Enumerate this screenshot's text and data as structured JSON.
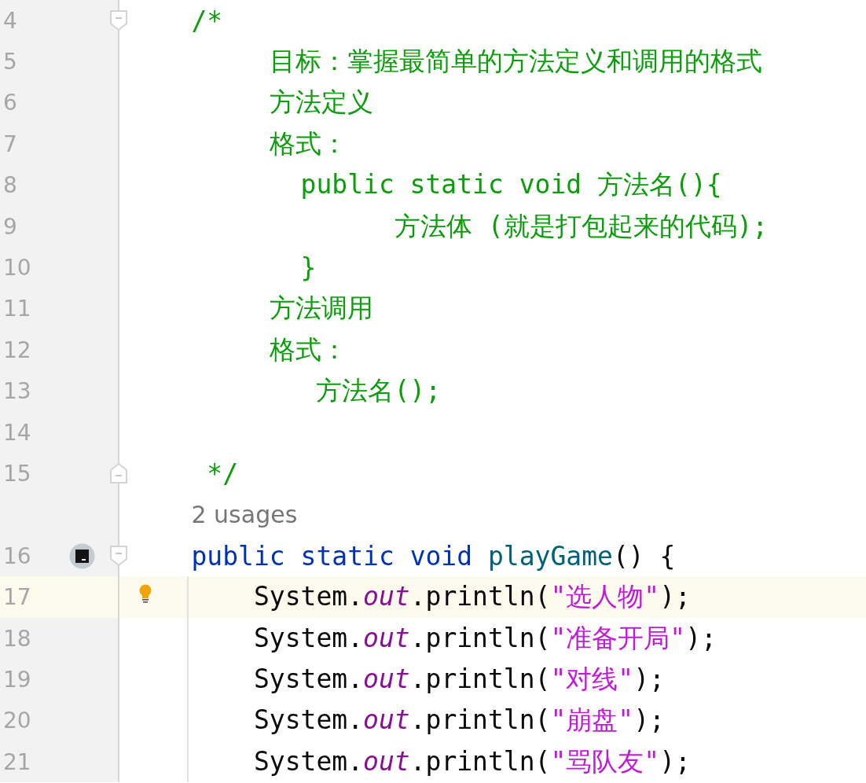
{
  "editor": {
    "lines": [
      {
        "kind": "code",
        "number": "4",
        "fold_start": true,
        "tokens": [
          {
            "kind": "comment",
            "text": "    /*"
          }
        ]
      },
      {
        "kind": "code",
        "number": "5",
        "tokens": [
          {
            "kind": "comment",
            "text": "         目标：掌握最简单的方法定义和调用的格式"
          }
        ]
      },
      {
        "kind": "code",
        "number": "6",
        "tokens": [
          {
            "kind": "comment",
            "text": "         方法定义"
          }
        ]
      },
      {
        "kind": "code",
        "number": "7",
        "tokens": [
          {
            "kind": "comment",
            "text": "         格式："
          }
        ]
      },
      {
        "kind": "code",
        "number": "8",
        "tokens": [
          {
            "kind": "comment",
            "text": "           public static void 方法名(){"
          }
        ]
      },
      {
        "kind": "code",
        "number": "9",
        "tokens": [
          {
            "kind": "comment",
            "text": "                 方法体 (就是打包起来的代码);"
          }
        ]
      },
      {
        "kind": "code",
        "number": "10",
        "tokens": [
          {
            "kind": "comment",
            "text": "           }"
          }
        ]
      },
      {
        "kind": "code",
        "number": "11",
        "tokens": [
          {
            "kind": "comment",
            "text": "         方法调用"
          }
        ]
      },
      {
        "kind": "code",
        "number": "12",
        "tokens": [
          {
            "kind": "comment",
            "text": "         格式："
          }
        ]
      },
      {
        "kind": "code",
        "number": "13",
        "tokens": [
          {
            "kind": "comment",
            "text": "            方法名();"
          }
        ]
      },
      {
        "kind": "code",
        "number": "14"
      },
      {
        "kind": "code",
        "number": "15",
        "fold_end": true,
        "tokens": [
          {
            "kind": "comment",
            "text": "     */"
          }
        ]
      },
      {
        "kind": "inlay",
        "text": "    2 usages"
      },
      {
        "kind": "code",
        "number": "16",
        "fold_start": true,
        "run_action": true,
        "tokens": [
          {
            "kind": "keyword",
            "text": "    public static void "
          },
          {
            "kind": "method",
            "text": "playGame"
          },
          {
            "kind": "plain",
            "text": "() {"
          }
        ]
      },
      {
        "kind": "code",
        "number": "17",
        "current": true,
        "guide": true,
        "hint_action": true,
        "tokens": [
          {
            "kind": "plain",
            "text": "        System."
          },
          {
            "kind": "field",
            "text": "out"
          },
          {
            "kind": "plain",
            "text": ".println("
          },
          {
            "kind": "string",
            "text": "\"选人物\""
          },
          {
            "kind": "plain",
            "text": ");"
          }
        ]
      },
      {
        "kind": "code",
        "number": "18",
        "guide": true,
        "tokens": [
          {
            "kind": "plain",
            "text": "        System."
          },
          {
            "kind": "field",
            "text": "out"
          },
          {
            "kind": "plain",
            "text": ".println("
          },
          {
            "kind": "string",
            "text": "\"准备开局\""
          },
          {
            "kind": "plain",
            "text": ");"
          }
        ]
      },
      {
        "kind": "code",
        "number": "19",
        "guide": true,
        "tokens": [
          {
            "kind": "plain",
            "text": "        System."
          },
          {
            "kind": "field",
            "text": "out"
          },
          {
            "kind": "plain",
            "text": ".println("
          },
          {
            "kind": "string",
            "text": "\"对线\""
          },
          {
            "kind": "plain",
            "text": ");"
          }
        ]
      },
      {
        "kind": "code",
        "number": "20",
        "guide": true,
        "tokens": [
          {
            "kind": "plain",
            "text": "        System."
          },
          {
            "kind": "field",
            "text": "out"
          },
          {
            "kind": "plain",
            "text": ".println("
          },
          {
            "kind": "string",
            "text": "\"崩盘\""
          },
          {
            "kind": "plain",
            "text": ");"
          }
        ]
      },
      {
        "kind": "code",
        "number": "21",
        "guide": true,
        "tokens": [
          {
            "kind": "plain",
            "text": "        System."
          },
          {
            "kind": "field",
            "text": "out"
          },
          {
            "kind": "plain",
            "text": ".println("
          },
          {
            "kind": "string",
            "text": "\"骂队友\""
          },
          {
            "kind": "plain",
            "text": ");"
          }
        ]
      }
    ]
  }
}
